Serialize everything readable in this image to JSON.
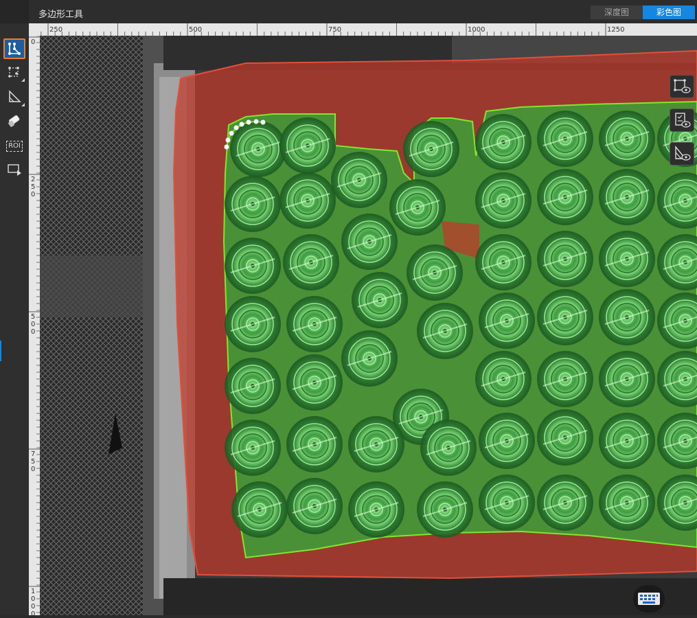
{
  "window": {
    "title": "多边形工具"
  },
  "view_toggle": {
    "depth_label": "深度图",
    "color_label": "彩色图",
    "active": "color"
  },
  "rulers": {
    "top_labels": [
      "250",
      "500",
      "750",
      "1000",
      "1250"
    ],
    "left_labels": [
      "0",
      "250",
      "500",
      "750",
      "1000"
    ]
  },
  "toolbar": {
    "tools": [
      {
        "name": "polygon-tool",
        "active": true
      },
      {
        "name": "point-edit-tool",
        "active": false
      },
      {
        "name": "ruler-angle-tool",
        "active": false
      },
      {
        "name": "eraser-tool",
        "active": false
      },
      {
        "name": "roi-tool",
        "label": "ROI",
        "active": false
      },
      {
        "name": "rect-select-tool",
        "active": false
      }
    ]
  },
  "overlays": {
    "container_color": "#c0392b",
    "objects_color": "#2fae3a",
    "outline_color": "#7ee82c"
  },
  "right_panel": {
    "buttons": [
      "polygon-visibility",
      "list-visibility",
      "ruler-visibility"
    ]
  }
}
